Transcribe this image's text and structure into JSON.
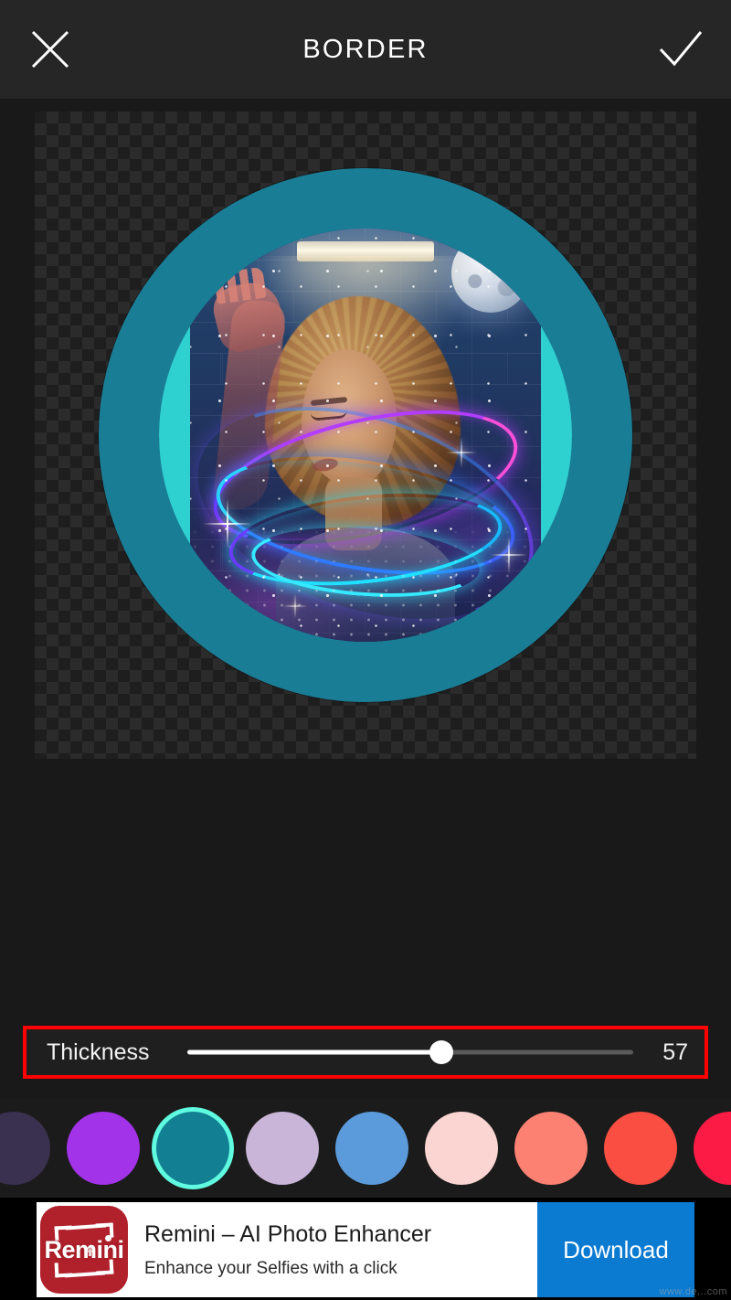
{
  "topbar": {
    "title": "BORDER",
    "close_icon": "close-x-icon",
    "confirm_icon": "checkmark-icon"
  },
  "editor": {
    "canvas_background": "transparent-checkerboard",
    "border_color": "#1a7d96",
    "letterbox_color": "#2ed0d0",
    "photo_description": "Woman with curly hair leaning against a blue brick wall, neon light swirls, moon and stars double exposure"
  },
  "slider": {
    "label": "Thickness",
    "value": "57",
    "percent": 57,
    "highlight_color": "#ff0000",
    "track_color": "#5a5a5a",
    "fill_color": "#ffffff"
  },
  "swatches": {
    "selected_index": 2,
    "selection_ring_color": "#5ffbe0",
    "items": [
      {
        "name": "dark-purple",
        "color": "#3a3050"
      },
      {
        "name": "violet",
        "color": "#a333e8"
      },
      {
        "name": "teal",
        "color": "#137f92"
      },
      {
        "name": "lilac",
        "color": "#c9b5d8"
      },
      {
        "name": "cornflower-blue",
        "color": "#5c9bdb"
      },
      {
        "name": "blush-pink",
        "color": "#fbd5d2"
      },
      {
        "name": "salmon",
        "color": "#fc8172"
      },
      {
        "name": "coral-red",
        "color": "#fb4e42"
      },
      {
        "name": "crimson",
        "color": "#fb1b45"
      }
    ]
  },
  "ad": {
    "logo_text": "Remini",
    "title": "Remini – AI Photo Enhancer",
    "subtitle": "Enhance your Selfies with a click",
    "cta": "Download",
    "cta_color": "#0b7ad1",
    "logo_color": "#b0212c",
    "watermark": "www.de...com"
  }
}
